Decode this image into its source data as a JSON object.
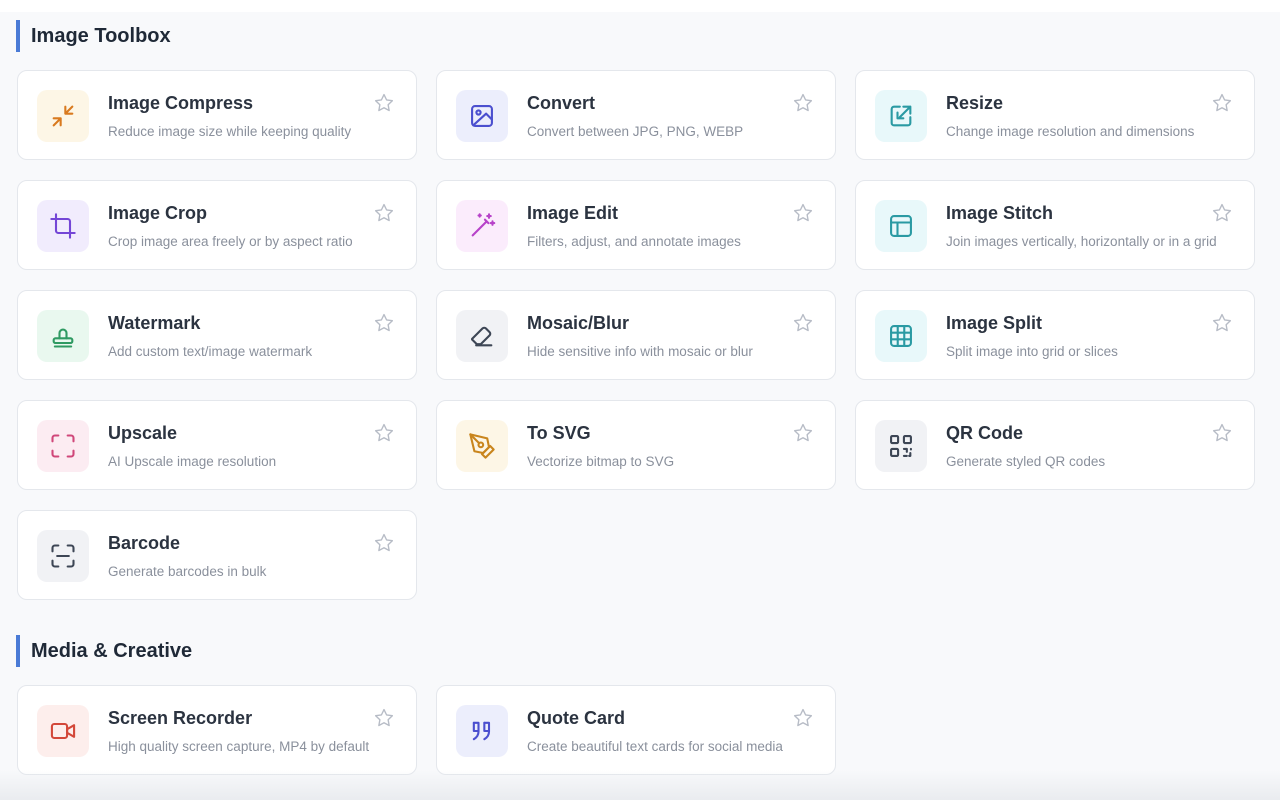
{
  "sections": [
    {
      "title": "Image Toolbox",
      "tools": [
        {
          "name": "Image Compress",
          "desc": "Reduce image size while keeping quality",
          "icon": "compress-icon",
          "color": "#d97a1f",
          "bg": "#fdf6e6"
        },
        {
          "name": "Convert",
          "desc": "Convert between JPG, PNG, WEBP",
          "icon": "image-icon",
          "color": "#4b4fcf",
          "bg": "#eceefc"
        },
        {
          "name": "Resize",
          "desc": "Change image resolution and dimensions",
          "icon": "resize-icon",
          "color": "#2a9aa3",
          "bg": "#e8f8fa"
        },
        {
          "name": "Image Crop",
          "desc": "Crop image area freely or by aspect ratio",
          "icon": "crop-icon",
          "color": "#7446d6",
          "bg": "#f1ecfd"
        },
        {
          "name": "Image Edit",
          "desc": "Filters, adjust, and annotate images",
          "icon": "magic-wand-icon",
          "color": "#b742c9",
          "bg": "#fbecfc"
        },
        {
          "name": "Image Stitch",
          "desc": "Join images vertically, horizontally or in a grid",
          "icon": "layout-icon",
          "color": "#2a9aa3",
          "bg": "#e8f8fa"
        },
        {
          "name": "Watermark",
          "desc": "Add custom text/image watermark",
          "icon": "stamp-icon",
          "color": "#2f9a62",
          "bg": "#e9f8ef"
        },
        {
          "name": "Mosaic/Blur",
          "desc": "Hide sensitive info with mosaic or blur",
          "icon": "eraser-icon",
          "color": "#3d4655",
          "bg": "#f1f2f5"
        },
        {
          "name": "Image Split",
          "desc": "Split image into grid or slices",
          "icon": "grid-icon",
          "color": "#2a9aa3",
          "bg": "#e8f8fa"
        },
        {
          "name": "Upscale",
          "desc": "AI Upscale image resolution",
          "icon": "expand-corners-icon",
          "color": "#d0477a",
          "bg": "#fcecf2"
        },
        {
          "name": "To SVG",
          "desc": "Vectorize bitmap to SVG",
          "icon": "pen-tool-icon",
          "color": "#c9851d",
          "bg": "#fdf6e6"
        },
        {
          "name": "QR Code",
          "desc": "Generate styled QR codes",
          "icon": "qr-code-icon",
          "color": "#3d4655",
          "bg": "#f1f2f5"
        },
        {
          "name": "Barcode",
          "desc": "Generate barcodes in bulk",
          "icon": "scan-icon",
          "color": "#3d4655",
          "bg": "#f1f2f5"
        }
      ]
    },
    {
      "title": "Media & Creative",
      "tools": [
        {
          "name": "Screen Recorder",
          "desc": "High quality screen capture, MP4 by default",
          "icon": "video-camera-icon",
          "color": "#d3483a",
          "bg": "#fdeeec"
        },
        {
          "name": "Quote Card",
          "desc": "Create beautiful text cards for social media",
          "icon": "quote-icon",
          "color": "#4b4fcf",
          "bg": "#eceefc"
        }
      ]
    }
  ]
}
